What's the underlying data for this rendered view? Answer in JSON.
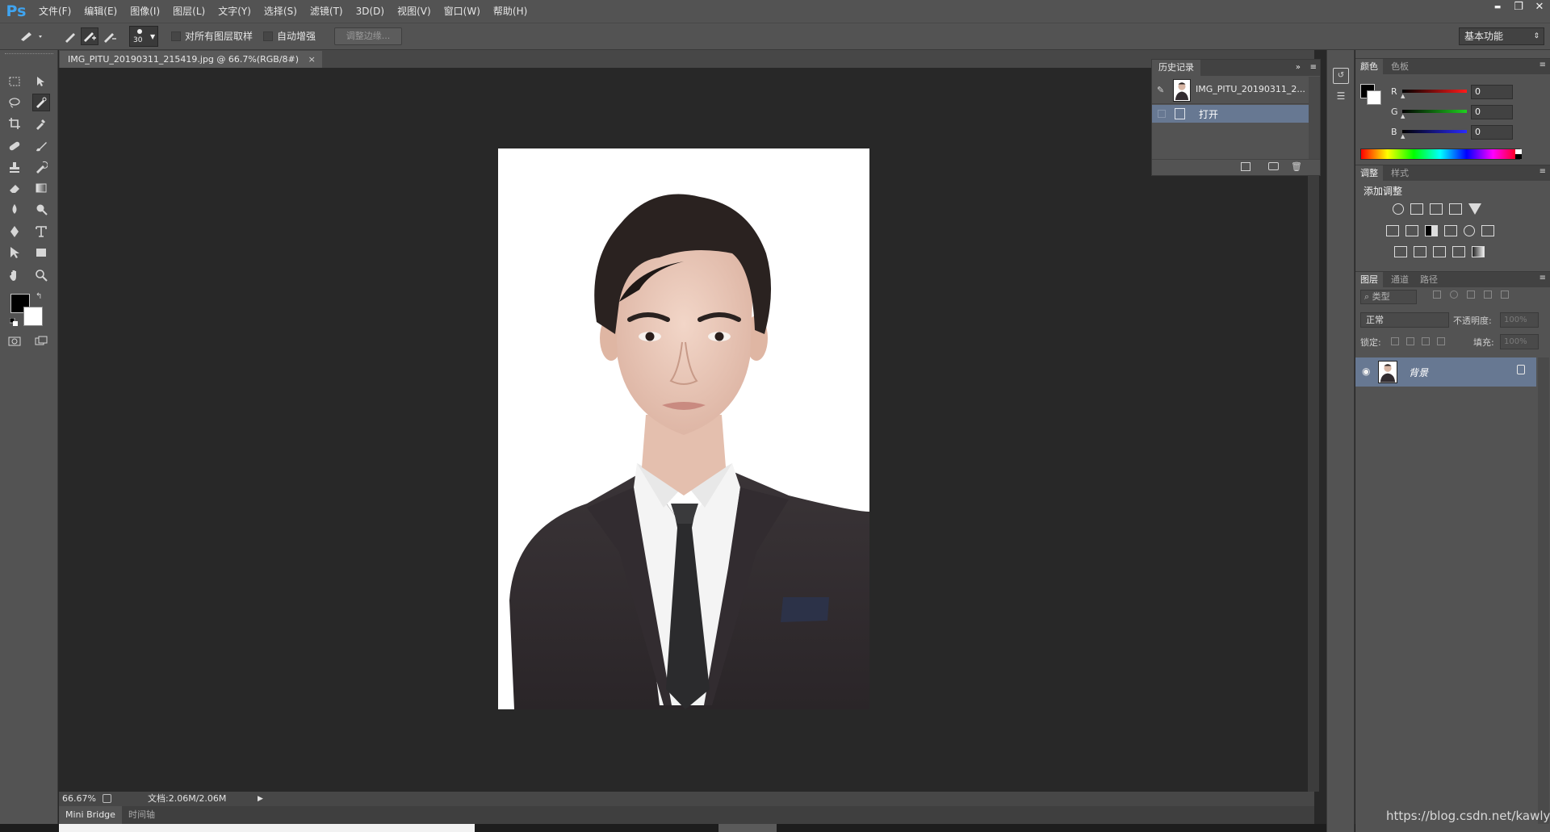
{
  "app": {
    "logo": "Ps"
  },
  "menu": [
    "文件(F)",
    "编辑(E)",
    "图像(I)",
    "图层(L)",
    "文字(Y)",
    "选择(S)",
    "滤镜(T)",
    "3D(D)",
    "视图(V)",
    "窗口(W)",
    "帮助(H)"
  ],
  "window_controls": {
    "minimize": "▬",
    "restore": "❐",
    "close": "✕"
  },
  "options": {
    "brush_size": "30",
    "sample_all_layers": "对所有图层取样",
    "auto_enhance": "自动增强",
    "refine_edge": "调整边缘...",
    "workspace": "基本功能"
  },
  "document": {
    "tab_title": "IMG_PITU_20190311_215419.jpg @ 66.7%(RGB/8#)",
    "close_symbol": "×",
    "zoom": "66.67%",
    "doc_size": "文档:2.06M/2.06M"
  },
  "bottom_tabs": [
    "Mini Bridge",
    "时间轴"
  ],
  "history": {
    "title": "历史记录",
    "snapshot_label": "IMG_PITU_20190311_2...",
    "steps": [
      "打开"
    ]
  },
  "color_panel": {
    "tabs": [
      "颜色",
      "色板"
    ],
    "channels": [
      {
        "label": "R",
        "value": "0",
        "color": "#d81f1f"
      },
      {
        "label": "G",
        "value": "0",
        "color": "#1fb81f"
      },
      {
        "label": "B",
        "value": "0",
        "color": "#2a2ad8"
      }
    ],
    "foreground": "#000000",
    "background": "#ffffff"
  },
  "adjustments_panel": {
    "tabs": [
      "调整",
      "样式"
    ],
    "heading": "添加调整"
  },
  "layers_panel": {
    "tabs": [
      "图层",
      "通道",
      "路径"
    ],
    "filter_kind": "类型",
    "blend_mode": "正常",
    "opacity_label": "不透明度:",
    "opacity_value": "100%",
    "lock_label": "锁定:",
    "fill_label": "填充:",
    "fill_value": "100%",
    "layers": [
      {
        "name": "背景",
        "visible": true,
        "locked": true
      }
    ]
  },
  "watermark": "https://blog.csdn.net/kawlyh"
}
